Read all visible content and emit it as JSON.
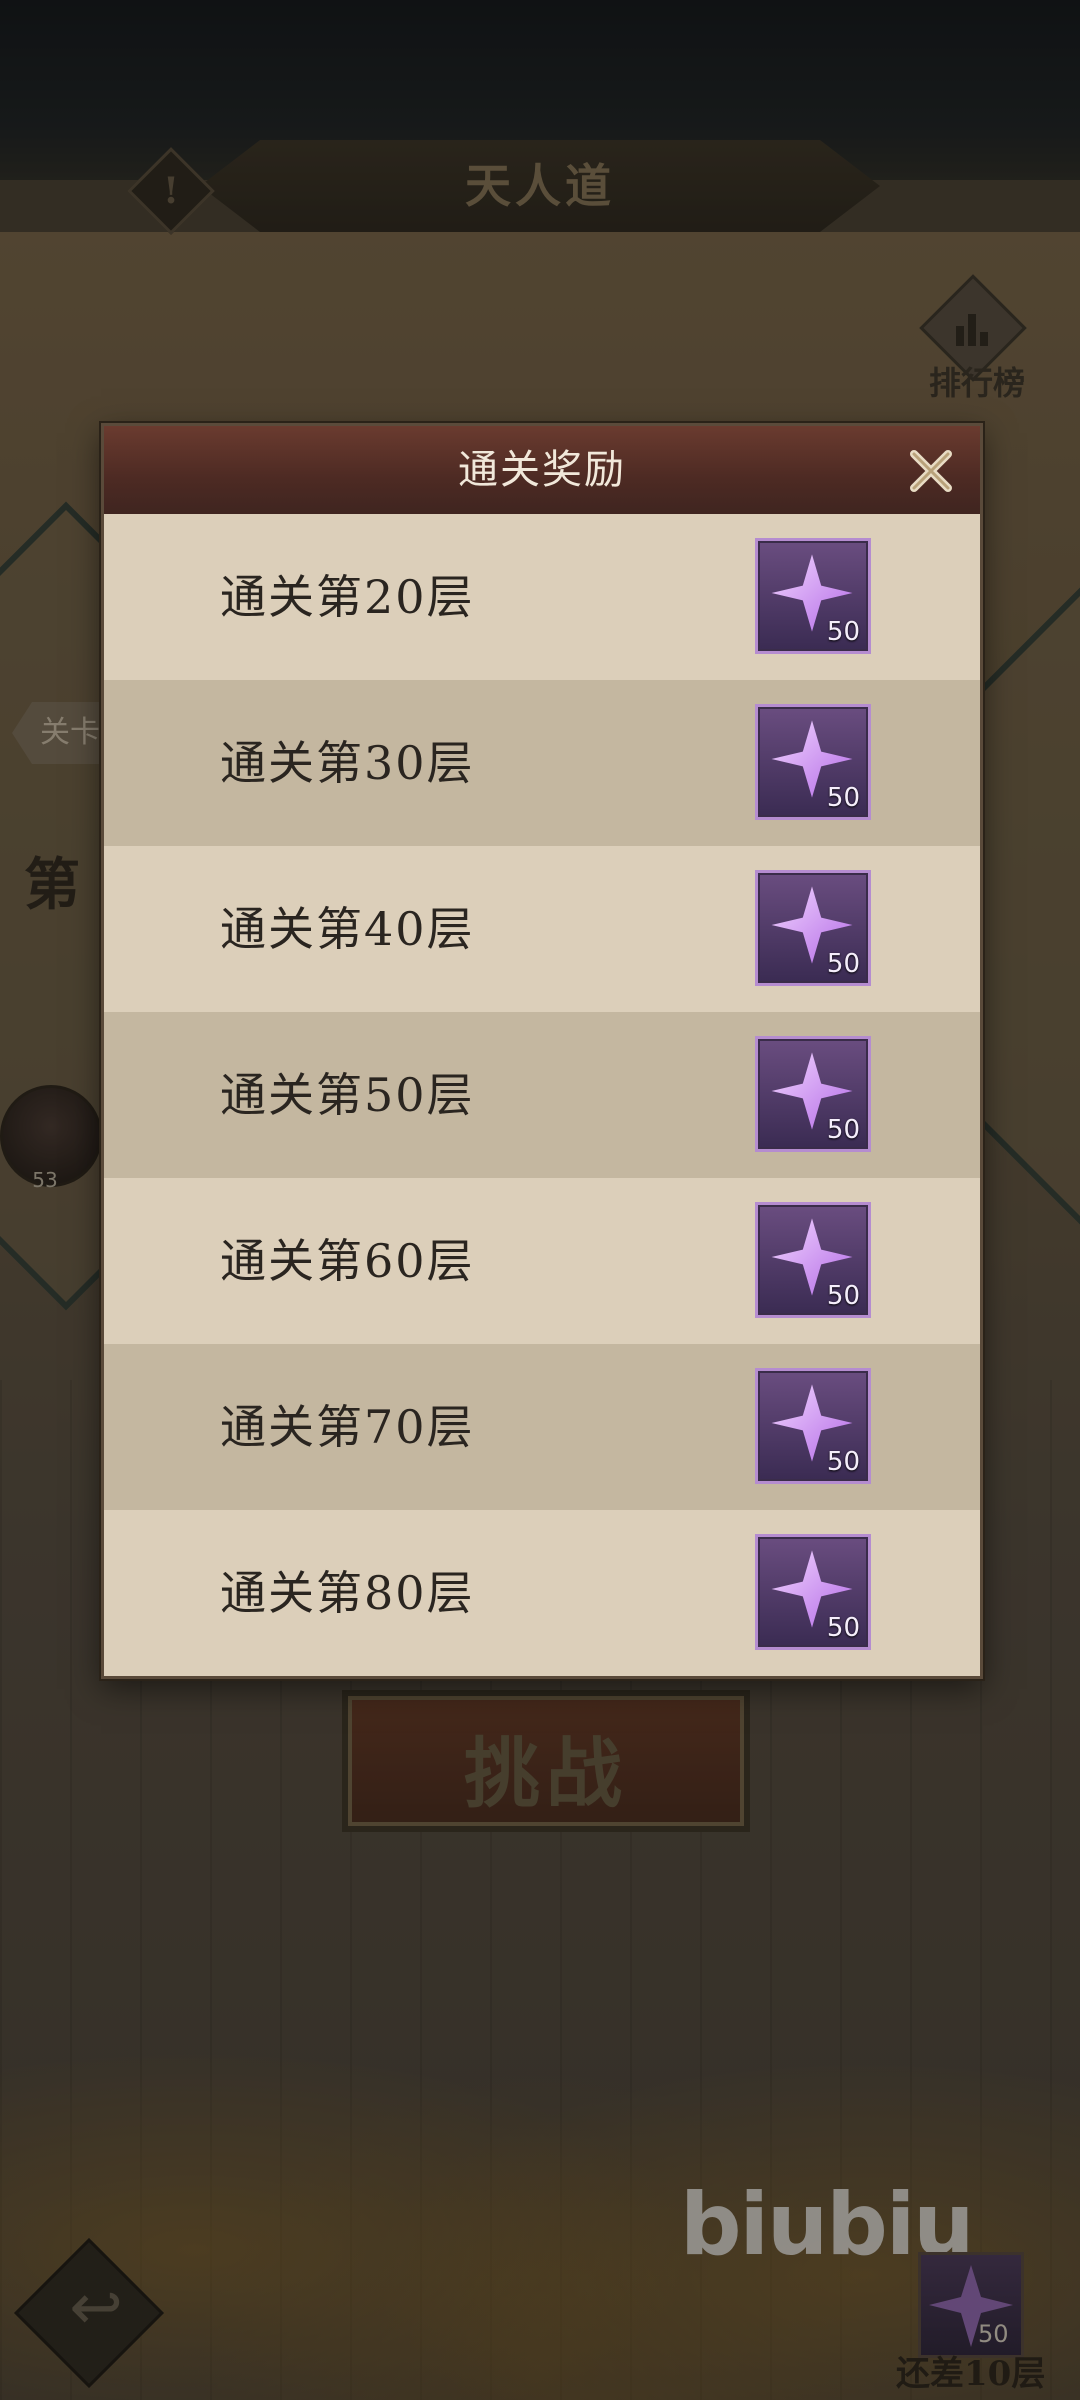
{
  "screen": {
    "title": "天人道",
    "info_icon": "!",
    "leaderboard_label": "排行榜",
    "side_tab_label": "关卡",
    "side_heading": "第",
    "avatar_level": "53",
    "challenge_label": "挑战",
    "back_icon": "back-arrow-icon",
    "watermark": "biubiu",
    "bottom_reward_count": "50",
    "bottom_remaining": "还差10层"
  },
  "modal": {
    "title": "通关奖励",
    "close_icon": "close-icon",
    "rows": [
      {
        "label": "通关第20层",
        "reward_count": "50",
        "reward_icon": "purple-star-gem-icon"
      },
      {
        "label": "通关第30层",
        "reward_count": "50",
        "reward_icon": "purple-star-gem-icon"
      },
      {
        "label": "通关第40层",
        "reward_count": "50",
        "reward_icon": "purple-star-gem-icon"
      },
      {
        "label": "通关第50层",
        "reward_count": "50",
        "reward_icon": "purple-star-gem-icon"
      },
      {
        "label": "通关第60层",
        "reward_count": "50",
        "reward_icon": "purple-star-gem-icon"
      },
      {
        "label": "通关第70层",
        "reward_count": "50",
        "reward_icon": "purple-star-gem-icon"
      },
      {
        "label": "通关第80层",
        "reward_count": "50",
        "reward_icon": "purple-star-gem-icon"
      }
    ]
  },
  "colors": {
    "modal_header": "#4d2a23",
    "row_light": "#dccfba",
    "row_dark": "#c4b7a0",
    "reward_frame": "#b58cd0",
    "gem": "#d9a6ff"
  }
}
